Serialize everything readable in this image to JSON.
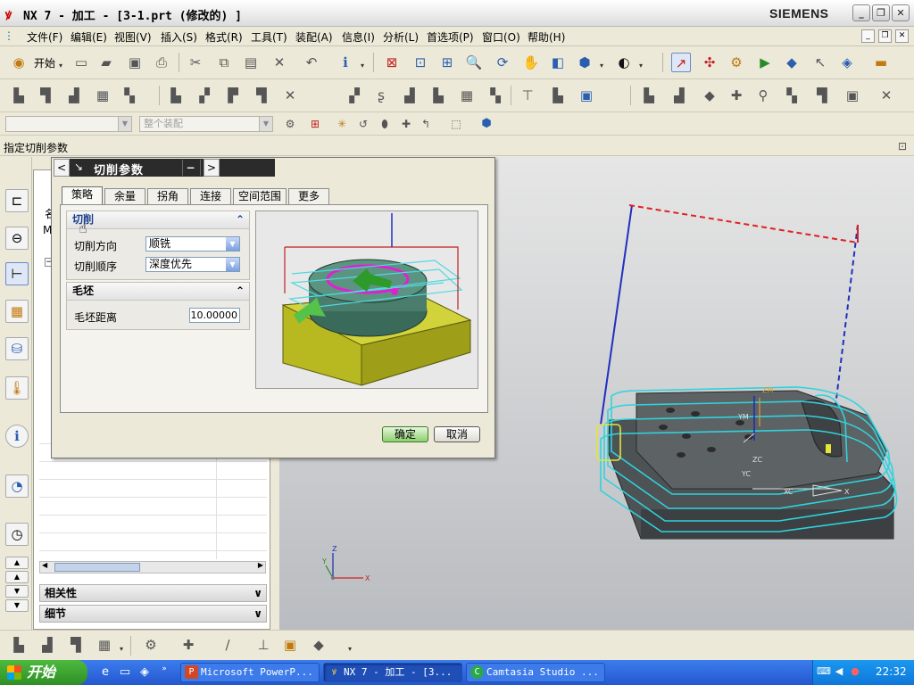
{
  "window": {
    "title": "NX 7 - 加工 - [3-1.prt  (修改的) ]",
    "brand": "SIEMENS"
  },
  "menu": [
    "文件(F)",
    "编辑(E)",
    "视图(V)",
    "插入(S)",
    "格式(R)",
    "工具(T)",
    "装配(A)",
    "信息(I)",
    "分析(L)",
    "首选项(P)",
    "窗口(O)",
    "帮助(H)"
  ],
  "toolbar": {
    "start_label": "开始",
    "filter_combo": "",
    "assembly_combo": "整个装配"
  },
  "cue_line": "指定切削参数",
  "dialog": {
    "title": "切削参数",
    "tabs": [
      "策略",
      "余量",
      "拐角",
      "连接",
      "空间范围",
      "更多"
    ],
    "active_tab": "策略",
    "groups": {
      "cut": {
        "title": "切削",
        "rows": [
          {
            "label": "切削方向",
            "value": "顺铣"
          },
          {
            "label": "切削顺序",
            "value": "深度优先"
          }
        ]
      },
      "blank": {
        "title": "毛坯",
        "rows": [
          {
            "label": "毛坯距离",
            "value": "10.00000"
          }
        ]
      }
    },
    "ok_label": "确定",
    "cancel_label": "取消"
  },
  "navigator": {
    "column_header_fragment": "名",
    "row_fragment": "M",
    "sections": [
      "相关性",
      "细节"
    ]
  },
  "viewport": {
    "axis_labels": [
      "ZM",
      "YM",
      "YC",
      "XC",
      "ZC",
      "X",
      "Z",
      "Y",
      "X"
    ]
  },
  "taskbar": {
    "start_label": "开始",
    "tasks": [
      "Microsoft PowerP...",
      "NX 7 - 加工 - [3...",
      "Camtasia Studio ..."
    ],
    "clock": "22:32"
  },
  "colors": {
    "toolpath": "#2fd3dd",
    "part": "#555a5c",
    "blank": "#c8c832",
    "rapid": "#2030c0",
    "retract": "#e02020"
  }
}
